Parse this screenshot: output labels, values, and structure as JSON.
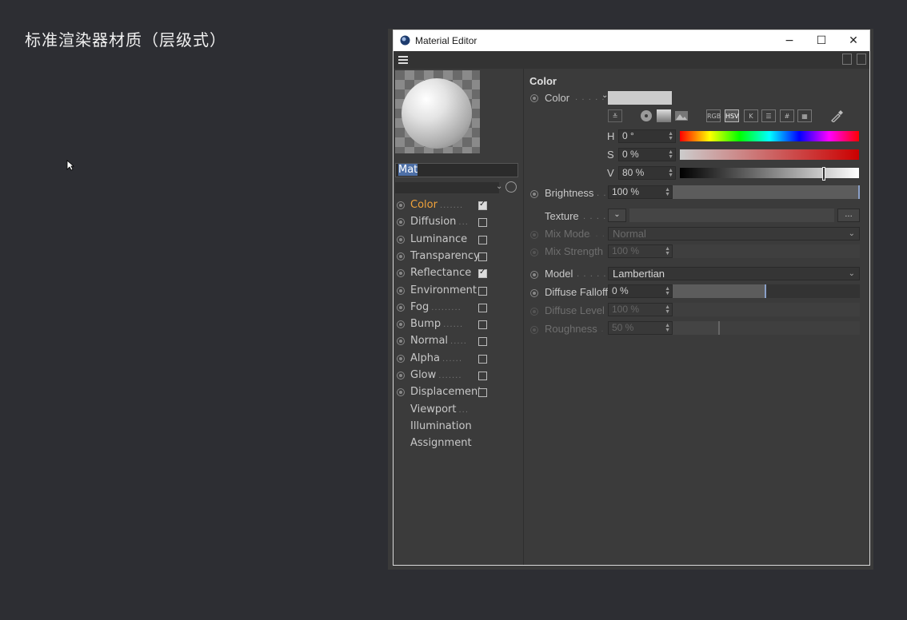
{
  "slide": {
    "title": "标准渲染器材质（层级式）"
  },
  "window": {
    "title": "Material Editor",
    "minimize_label": "−",
    "maximize_label": "☐",
    "close_label": "✕"
  },
  "material": {
    "name": "Mat"
  },
  "channels": [
    {
      "label": "Color",
      "checked": true,
      "active": true
    },
    {
      "label": "Diffusion",
      "checked": false
    },
    {
      "label": "Luminance",
      "checked": false
    },
    {
      "label": "Transparency",
      "checked": false
    },
    {
      "label": "Reflectance",
      "checked": true
    },
    {
      "label": "Environment",
      "checked": false
    },
    {
      "label": "Fog",
      "checked": false
    },
    {
      "label": "Bump",
      "checked": false
    },
    {
      "label": "Normal",
      "checked": false
    },
    {
      "label": "Alpha",
      "checked": false
    },
    {
      "label": "Glow",
      "checked": false
    },
    {
      "label": "Displacement",
      "checked": false
    },
    {
      "label": "Viewport"
    },
    {
      "label": "Illumination"
    },
    {
      "label": "Assignment"
    }
  ],
  "color_section": {
    "title": "Color",
    "color_label": "Color",
    "color_value": "#cccccc",
    "mode_buttons": [
      "RGB",
      "HSV",
      "K",
      "#"
    ],
    "h_label": "H",
    "h_value": "0 °",
    "s_label": "S",
    "s_value": "0 %",
    "v_label": "V",
    "v_value": "80 %",
    "brightness_label": "Brightness",
    "brightness_value": "100 %",
    "brightness_level": 1.0,
    "texture_label": "Texture",
    "texture_more": "...",
    "mix_mode_label": "Mix Mode",
    "mix_mode_value": "Normal",
    "mix_strength_label": "Mix Strength",
    "mix_strength_value": "100 %",
    "model_label": "Model",
    "model_value": "Lambertian",
    "diffuse_falloff_label": "Diffuse Falloff",
    "diffuse_falloff_value": "0 %",
    "diffuse_falloff_level": 0.5,
    "diffuse_level_label": "Diffuse Level",
    "diffuse_level_value": "100 %",
    "roughness_label": "Roughness",
    "roughness_value": "50 %",
    "roughness_level": 0.25
  }
}
